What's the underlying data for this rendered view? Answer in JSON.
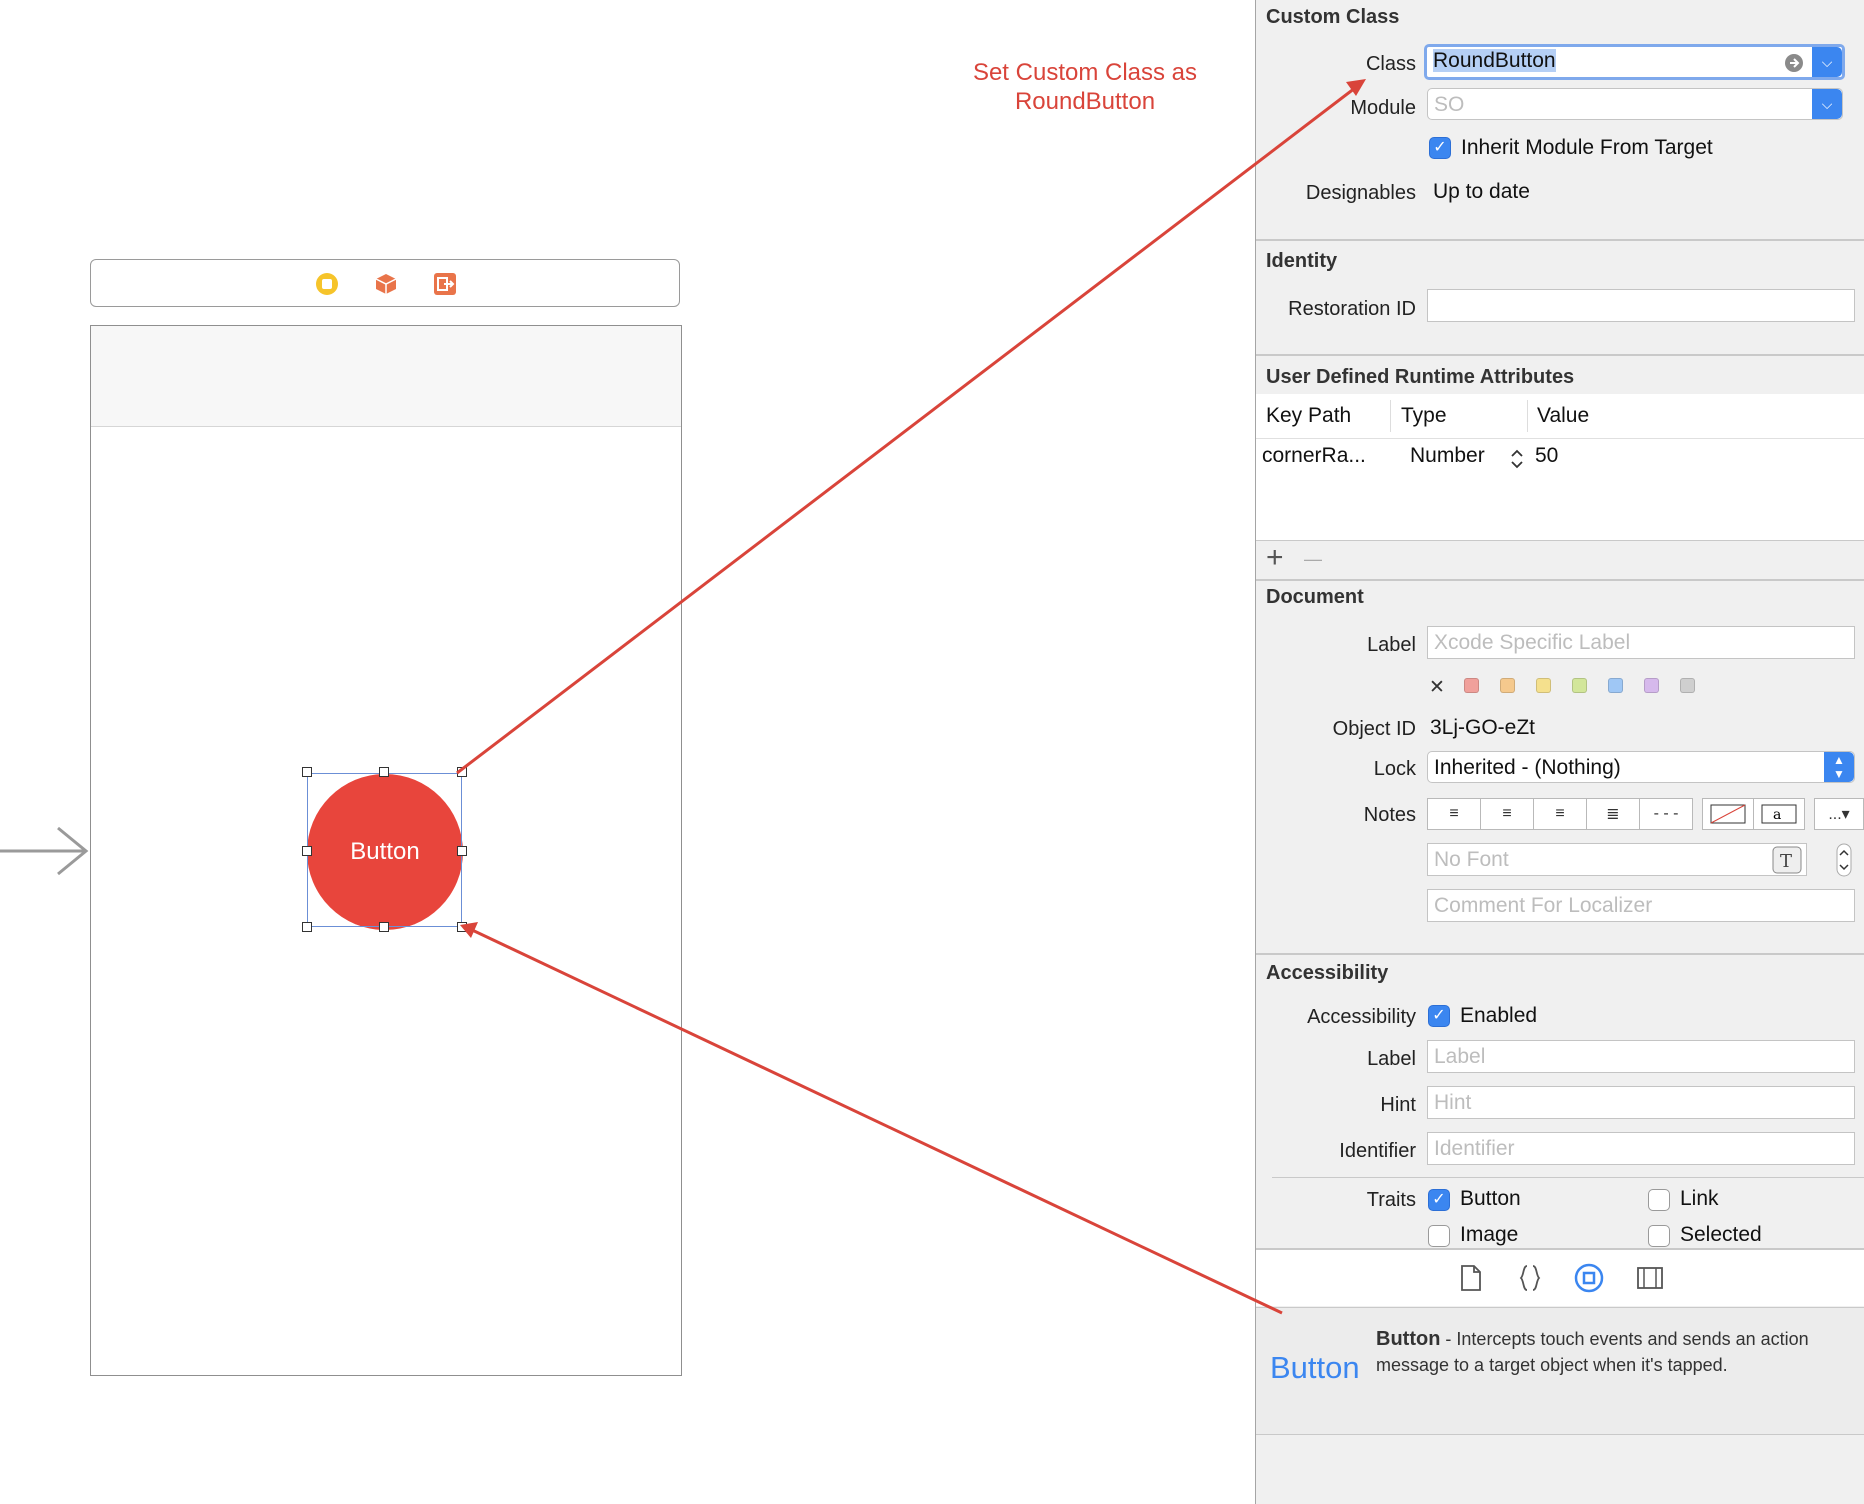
{
  "annotation": {
    "line1": "Set Custom Class as",
    "line2": "RoundButton",
    "color": "#d9443a"
  },
  "canvas": {
    "button_label": "Button",
    "button_color": "#e8453c"
  },
  "custom_class": {
    "title": "Custom Class",
    "class_label": "Class",
    "class_value": "RoundButton",
    "module_label": "Module",
    "module_placeholder": "SO",
    "inherit_label": "Inherit Module From Target",
    "designables_label": "Designables",
    "designables_value": "Up to date"
  },
  "identity": {
    "title": "Identity",
    "restoration_label": "Restoration ID"
  },
  "runtime_attributes": {
    "title": "User Defined Runtime Attributes",
    "columns": [
      "Key Path",
      "Type",
      "Value"
    ],
    "rows": [
      {
        "key_path": "cornerRa...",
        "type": "Number",
        "value": "50"
      }
    ],
    "add": "+",
    "remove": "—"
  },
  "document": {
    "title": "Document",
    "label_label": "Label",
    "label_placeholder": "Xcode Specific Label",
    "object_id_label": "Object ID",
    "object_id_value": "3Lj-GO-eZt",
    "lock_label": "Lock",
    "lock_value": "Inherited - (Nothing)",
    "notes_label": "Notes",
    "font_placeholder": "No Font",
    "comment_placeholder": "Comment For Localizer",
    "clear_color_glyph": "✕",
    "swatch_colors": [
      "#f0a09b",
      "#f5c98d",
      "#f5e08d",
      "#d2e69a",
      "#9fc7f5",
      "#d6b9ec",
      "#cfcfcf"
    ],
    "more_glyph": "...▾"
  },
  "accessibility": {
    "title": "Accessibility",
    "accessibility_label": "Accessibility",
    "enabled_label": "Enabled",
    "label_label": "Label",
    "label_placeholder": "Label",
    "hint_label": "Hint",
    "hint_placeholder": "Hint",
    "identifier_label": "Identifier",
    "identifier_placeholder": "Identifier",
    "traits_label": "Traits",
    "trait_button": "Button",
    "trait_link": "Link",
    "trait_image": "Image",
    "trait_selected": "Selected"
  },
  "help": {
    "big_title": "Button",
    "bold_name": "Button",
    "description": " - Intercepts touch events and sends an action message to a target object when it's tapped."
  },
  "accent_color": "#3b86f0"
}
